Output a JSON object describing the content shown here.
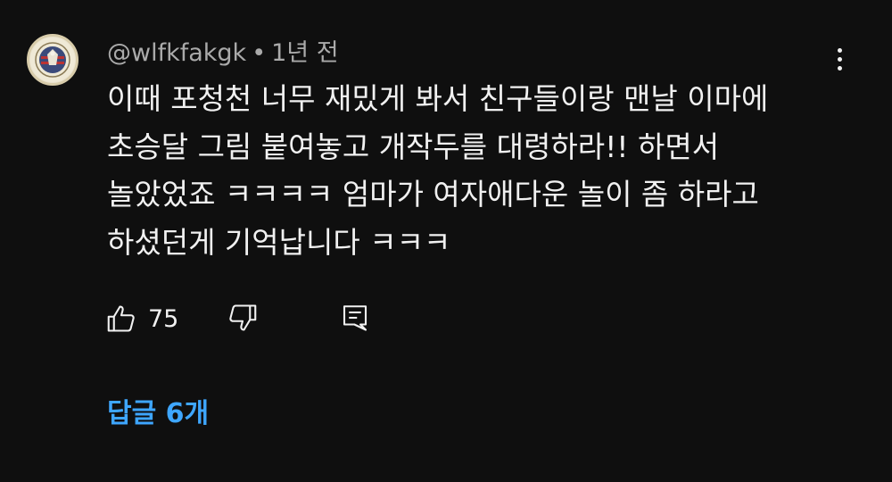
{
  "comment": {
    "author": "@wlfkfakgk",
    "separator": "•",
    "time": "1년 전",
    "lines": [
      "이때 포청천 너무 재밌게 봐서 친구들이랑 맨날 이마에",
      "초승달 그림 붙여놓고 개작두를 대령하라!! 하면서",
      "놀았었죠 ㅋㅋㅋㅋ 엄마가 여자애다운 놀이 좀 하라고",
      "하셨던게 기억납니다 ㅋㅋㅋ"
    ]
  },
  "actions": {
    "like_count": "75",
    "like_icon": "thumbs-up-icon",
    "dislike_icon": "thumbs-down-icon",
    "reply_icon": "reply-comment-icon"
  },
  "more_icon": "more-vertical-icon",
  "replies": {
    "label": "답글 6개"
  },
  "colors": {
    "background": "#0f0f0f",
    "text": "#f1f1f1",
    "secondary_text": "#aaaaaa",
    "link": "#3ea6ff"
  }
}
